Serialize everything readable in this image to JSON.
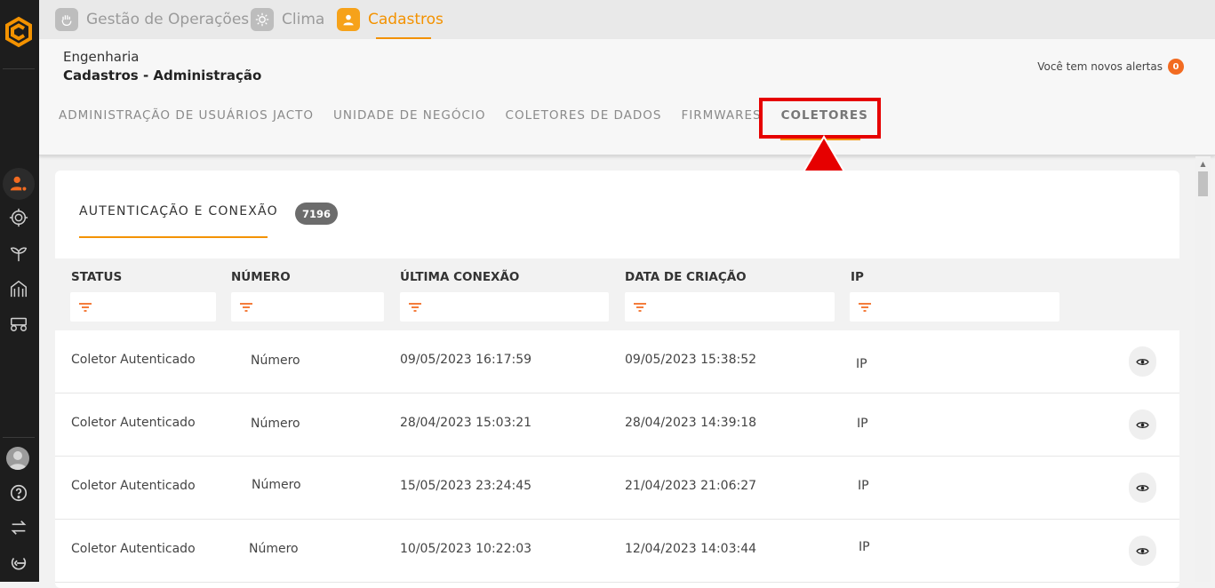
{
  "app_tabs": [
    {
      "label": "Gestão de Operações",
      "icon": "hand-icon"
    },
    {
      "label": "Clima",
      "icon": "sun-icon"
    },
    {
      "label": "Cadastros",
      "icon": "user-icon",
      "active": true
    }
  ],
  "breadcrumb": {
    "parent": "Engenharia",
    "current": "Cadastros - Administração"
  },
  "alerts": {
    "text": "Você tem novos alertas",
    "count": "0"
  },
  "subnav": [
    {
      "label": "ADMINISTRAÇÃO DE USUÁRIOS JACTO"
    },
    {
      "label": "UNIDADE DE NEGÓCIO"
    },
    {
      "label": "COLETORES DE DADOS"
    },
    {
      "label": "FIRMWARES"
    },
    {
      "label": "COLETORES",
      "active": true
    }
  ],
  "card": {
    "tab_label": "AUTENTICAÇÃO E CONEXÃO",
    "count": "7196"
  },
  "table": {
    "columns": [
      "STATUS",
      "NÚMERO",
      "ÚLTIMA CONEXÃO",
      "DATA DE CRIAÇÃO",
      "IP"
    ],
    "rows": [
      {
        "status": "Coletor Autenticado",
        "numero": "Número",
        "ultima": "09/05/2023 16:17:59",
        "criacao": "09/05/2023 15:38:52",
        "ip": "IP"
      },
      {
        "status": "Coletor Autenticado",
        "numero": "Número",
        "ultima": "28/04/2023 15:03:21",
        "criacao": "28/04/2023 14:39:18",
        "ip": "IP"
      },
      {
        "status": "Coletor Autenticado",
        "numero": "Número",
        "ultima": "15/05/2023 23:24:45",
        "criacao": "21/04/2023 21:06:27",
        "ip": "IP"
      },
      {
        "status": "Coletor Autenticado",
        "numero": "Número",
        "ultima": "10/05/2023 10:22:03",
        "criacao": "12/04/2023 14:03:44",
        "ip": "IP"
      }
    ]
  },
  "colors": {
    "accent": "#f39200",
    "highlight": "#e60000",
    "sidebar": "#1d1d1d"
  }
}
